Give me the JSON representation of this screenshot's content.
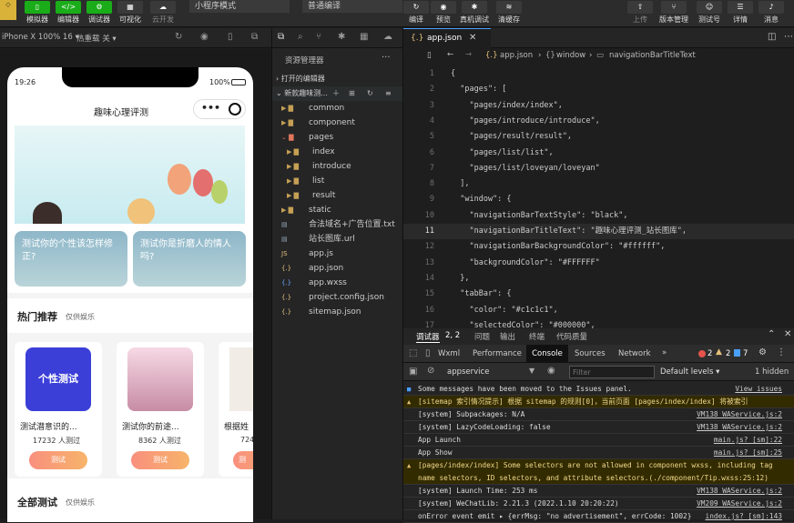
{
  "toolbar": {
    "buttons": [
      {
        "label": "模拟器"
      },
      {
        "label": "编辑器"
      },
      {
        "label": "调试器"
      },
      {
        "label": "可视化"
      },
      {
        "label": "云开发"
      }
    ],
    "mode_select": "小程序模式",
    "compile_select": "普通编译",
    "right_buttons": [
      {
        "label": "编译"
      },
      {
        "label": "预览"
      },
      {
        "label": "真机调试"
      },
      {
        "label": "清缓存"
      }
    ],
    "far_right": [
      {
        "label": "上传"
      },
      {
        "label": "版本管理"
      },
      {
        "label": "测试号"
      },
      {
        "label": "详情"
      },
      {
        "label": "消息"
      }
    ]
  },
  "simbar": {
    "device": "iPhone X 100% 16 ▾",
    "hot_reload": "热重载 关 ▾"
  },
  "phone": {
    "time": "19:26",
    "battery": "100%",
    "nav_title": "趣味心理评测",
    "cards": [
      {
        "title": "测试你的个性该怎样修正?"
      },
      {
        "title": "测试你是折磨人的情人吗?"
      }
    ],
    "hot_section": {
      "title": "热门推荐",
      "sub": "仅供娱乐"
    },
    "hot_items": [
      {
        "name": "测试潜意识的...",
        "count": "17232 人测过",
        "btn": "测试",
        "thumb_text": "个性测试"
      },
      {
        "name": "测试你的前途...",
        "count": "8362 人测过",
        "btn": "测试"
      },
      {
        "name": "根据姓",
        "count": "724",
        "btn": "测"
      }
    ],
    "all_section": {
      "title": "全部测试",
      "sub": "仅供娱乐"
    }
  },
  "explorer": {
    "header": "资源管理器",
    "open_editors": "打开的编辑器",
    "project": "新款趣味测...",
    "tree": [
      {
        "name": "common",
        "type": "folder",
        "depth": 1
      },
      {
        "name": "component",
        "type": "folder",
        "depth": 1
      },
      {
        "name": "pages",
        "type": "folder-open",
        "depth": 1
      },
      {
        "name": "index",
        "type": "folder",
        "depth": 2
      },
      {
        "name": "introduce",
        "type": "folder",
        "depth": 2
      },
      {
        "name": "list",
        "type": "folder",
        "depth": 2
      },
      {
        "name": "result",
        "type": "folder",
        "depth": 2
      },
      {
        "name": "static",
        "type": "folder",
        "depth": 1
      },
      {
        "name": "合法域名+广告位置.txt",
        "type": "file",
        "depth": 1
      },
      {
        "name": "站长图库.url",
        "type": "file",
        "depth": 1
      },
      {
        "name": "app.js",
        "type": "js",
        "depth": 1
      },
      {
        "name": "app.json",
        "type": "json",
        "depth": 1
      },
      {
        "name": "app.wxss",
        "type": "wxss",
        "depth": 1
      },
      {
        "name": "project.config.json",
        "type": "json",
        "depth": 1
      },
      {
        "name": "sitemap.json",
        "type": "json",
        "depth": 1
      }
    ]
  },
  "editor": {
    "tab": "app.json",
    "breadcrumb": {
      "file": "app.json",
      "path1": "window",
      "path2": "navigationBarTitleText"
    },
    "lines": [
      {
        "n": "1",
        "text": "{"
      },
      {
        "n": "2",
        "text": "  \"pages\": ["
      },
      {
        "n": "3",
        "text": "    \"pages/index/index\","
      },
      {
        "n": "4",
        "text": "    \"pages/introduce/introduce\","
      },
      {
        "n": "5",
        "text": "    \"pages/result/result\","
      },
      {
        "n": "6",
        "text": "    \"pages/list/list\","
      },
      {
        "n": "7",
        "text": "    \"pages/list/loveyan/loveyan\""
      },
      {
        "n": "8",
        "text": "  ],"
      },
      {
        "n": "9",
        "text": "  \"window\": {"
      },
      {
        "n": "10",
        "text": "    \"navigationBarTextStyle\": \"black\","
      },
      {
        "n": "11",
        "text": "    \"navigationBarTitleText\": \"趣味心理评测_站长图库\","
      },
      {
        "n": "12",
        "text": "    \"navigationBarBackgroundColor\": \"#ffffff\","
      },
      {
        "n": "13",
        "text": "    \"backgroundColor\": \"#FFFFFF\""
      },
      {
        "n": "14",
        "text": "  },"
      },
      {
        "n": "15",
        "text": "  \"tabBar\": {"
      },
      {
        "n": "16",
        "text": "    \"color\": \"#c1c1c1\","
      },
      {
        "n": "17",
        "text": "    \"selectedColor\": \"#000000\","
      }
    ]
  },
  "devtools": {
    "panel_tabs": [
      "调试器",
      "2, 2",
      "问题",
      "输出",
      "终端",
      "代码质量"
    ],
    "tabs": [
      "Wxml",
      "Performance",
      "Console",
      "Sources",
      "Network",
      "»"
    ],
    "counts": {
      "errors": "2",
      "warnings": "2",
      "info": "7"
    },
    "context": "appservice",
    "filter_placeholder": "Filter",
    "levels": "Default levels ▾",
    "hidden": "1 hidden",
    "rows": [
      {
        "type": "info",
        "text": "Some messages have been moved to the Issues panel.",
        "src": "View issues"
      },
      {
        "type": "warn",
        "text": "[sitemap 索引情况提示] 根据 sitemap 的规则[0]，当前页面 [pages/index/index] 将被索引",
        "src": ""
      },
      {
        "type": "log",
        "text": "[system] Subpackages: N/A",
        "src": "VM138 WAService.js:2"
      },
      {
        "type": "log",
        "text": "[system] LazyCodeLoading: false",
        "src": "VM138 WAService.js:2"
      },
      {
        "type": "log",
        "text": "App Launch",
        "src": "main.js? [sm]:22"
      },
      {
        "type": "log",
        "text": "App Show",
        "src": "main.js? [sm]:25"
      },
      {
        "type": "warn2",
        "text": "[pages/index/index] Some selectors are not allowed in component wxss, including tag\nname selectors, ID selectors, and attribute selectors.(./component/Tip.wxss:25:12)",
        "src": ""
      },
      {
        "type": "log",
        "text": "[system] Launch Time: 253 ms",
        "src": "VM138 WAService.js:2"
      },
      {
        "type": "log",
        "text": "[system] WeChatLib: 2.21.3 (2022.1.10 20:20:22)",
        "src": "VM209 WAService.js:2"
      },
      {
        "type": "log",
        "text": "onError event emit ▸ {errMsg: \"no advertisement\", errCode: 1002}",
        "src": "index.js? [sm]:143"
      }
    ]
  }
}
